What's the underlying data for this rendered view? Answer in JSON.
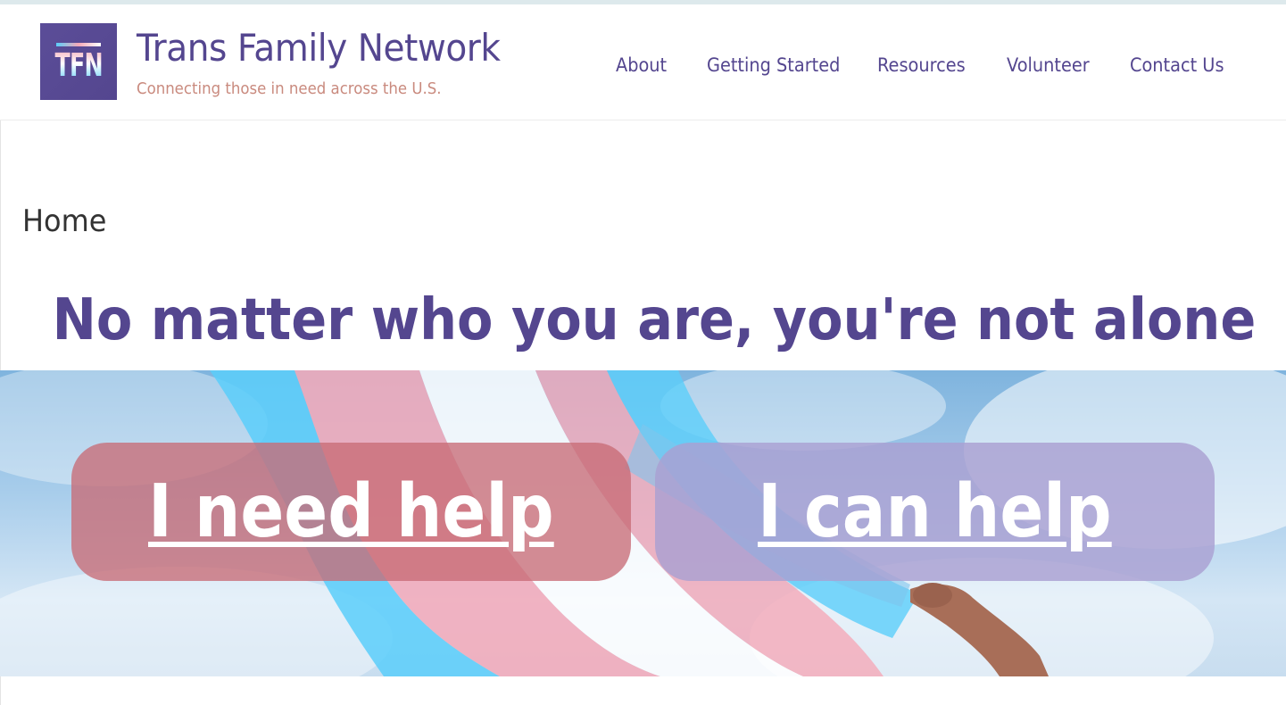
{
  "site": {
    "logo_text": "TFN",
    "title": "Trans Family Network",
    "tagline": "Connecting those in need across the U.S."
  },
  "nav": {
    "items": [
      {
        "label": "About"
      },
      {
        "label": "Getting Started"
      },
      {
        "label": "Resources"
      },
      {
        "label": "Volunteer"
      },
      {
        "label": "Contact Us"
      }
    ]
  },
  "page": {
    "breadcrumb": "Home",
    "headline": "No matter who you are, you're not alone"
  },
  "hero": {
    "image": "transgender-pride-flag-waving-against-sky",
    "cta_need_help": "I need help",
    "cta_can_help": "I can help"
  },
  "colors": {
    "brand_purple": "#54468f",
    "tagline": "#c98a7e",
    "need_help_button": "#c86c76",
    "can_help_button": "#aaa0d2",
    "flag_blue": "#5bcefa",
    "flag_pink": "#f5a9b8",
    "flag_white": "#ffffff"
  }
}
